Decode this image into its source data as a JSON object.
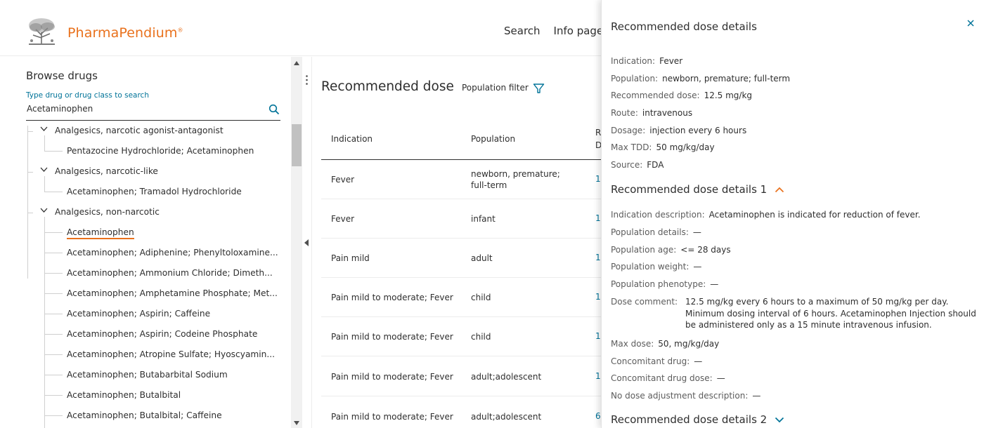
{
  "header": {
    "brand": "PharmaPendium",
    "brand_mark": "®",
    "nav": [
      "Search",
      "Info page"
    ]
  },
  "browse": {
    "title": "Browse drugs",
    "search_label": "Type drug or drug class to search",
    "search_value": "Acetaminophen",
    "tree": [
      {
        "label": "Analgesics, narcotic agonist-antagonist",
        "level": 1,
        "expanded": true
      },
      {
        "label": "Pentazocine Hydrochloride; Acetaminophen",
        "level": 2
      },
      {
        "label": "Analgesics, narcotic-like",
        "level": 1,
        "expanded": true
      },
      {
        "label": "Acetaminophen; Tramadol Hydrochloride",
        "level": 2
      },
      {
        "label": "Analgesics, non-narcotic",
        "level": 1,
        "expanded": true
      },
      {
        "label": "Acetaminophen",
        "level": 2,
        "selected": true
      },
      {
        "label": "Acetaminophen; Adiphenine; Phenyltoloxamine...",
        "level": 2
      },
      {
        "label": "Acetaminophen; Ammonium Chloride; Dimeth...",
        "level": 2
      },
      {
        "label": "Acetaminophen; Amphetamine Phosphate; Met...",
        "level": 2
      },
      {
        "label": "Acetaminophen; Aspirin; Caffeine",
        "level": 2
      },
      {
        "label": "Acetaminophen; Aspirin; Codeine Phosphate",
        "level": 2
      },
      {
        "label": "Acetaminophen; Atropine Sulfate; Hyoscyamin...",
        "level": 2
      },
      {
        "label": "Acetaminophen; Butabarbital Sodium",
        "level": 2
      },
      {
        "label": "Acetaminophen; Butalbital",
        "level": 2
      },
      {
        "label": "Acetaminophen; Butalbital; Caffeine",
        "level": 2
      }
    ]
  },
  "main": {
    "title": "Recommended dose",
    "filter_label": "Population filter",
    "columns": [
      "Indication",
      "Population",
      "R",
      "D"
    ],
    "rows": [
      {
        "indication": "Fever",
        "population": "newborn, premature; full-term",
        "dose": "1"
      },
      {
        "indication": "Fever",
        "population": "infant",
        "dose": "1"
      },
      {
        "indication": "Pain mild",
        "population": "adult",
        "dose": "1"
      },
      {
        "indication": "Pain mild to moderate; Fever",
        "population": "child",
        "dose": "1"
      },
      {
        "indication": "Pain mild to moderate; Fever",
        "population": "child",
        "dose": "1"
      },
      {
        "indication": "Pain mild to moderate; Fever",
        "population": "adult;adolescent",
        "dose": "1"
      },
      {
        "indication": "Pain mild to moderate; Fever",
        "population": "adult;adolescent",
        "dose": "6"
      }
    ]
  },
  "detail": {
    "title": "Recommended dose details",
    "summary": [
      {
        "k": "Indication:",
        "v": "Fever"
      },
      {
        "k": "Population:",
        "v": "newborn, premature; full-term"
      },
      {
        "k": "Recommended dose:",
        "v": "12.5 mg/kg"
      },
      {
        "k": "Route:",
        "v": "intravenous"
      },
      {
        "k": "Dosage:",
        "v": "injection every 6 hours"
      },
      {
        "k": "Max TDD:",
        "v": "50 mg/kg/day"
      },
      {
        "k": "Source:",
        "v": "FDA"
      }
    ],
    "section1_title": "Recommended dose details 1",
    "section1": [
      {
        "k": "Indication description:",
        "v": "Acetaminophen is indicated for reduction of fever."
      },
      {
        "k": "Population details:",
        "v": "—"
      },
      {
        "k": "Population age:",
        "v": "<= 28 days"
      },
      {
        "k": "Population weight:",
        "v": "—"
      },
      {
        "k": "Population phenotype:",
        "v": "—"
      }
    ],
    "dose_comment_label": "Dose comment:",
    "dose_comment": "12.5 mg/kg every 6 hours to a maximum of 50 mg/kg per day. Minimum dosing interval of 6 hours. Acetaminophen Injection should be administered only as a 15 minute intravenous infusion.",
    "section1_rest": [
      {
        "k": "Max dose:",
        "v": "50, mg/kg/day"
      },
      {
        "k": "Concomitant drug:",
        "v": "—"
      },
      {
        "k": "Concomitant drug dose:",
        "v": "—"
      },
      {
        "k": "No dose adjustment description:",
        "v": "—"
      }
    ],
    "section2_title": "Recommended dose details 2",
    "colors": {
      "accent": "#e9711c",
      "link": "#007398"
    }
  }
}
